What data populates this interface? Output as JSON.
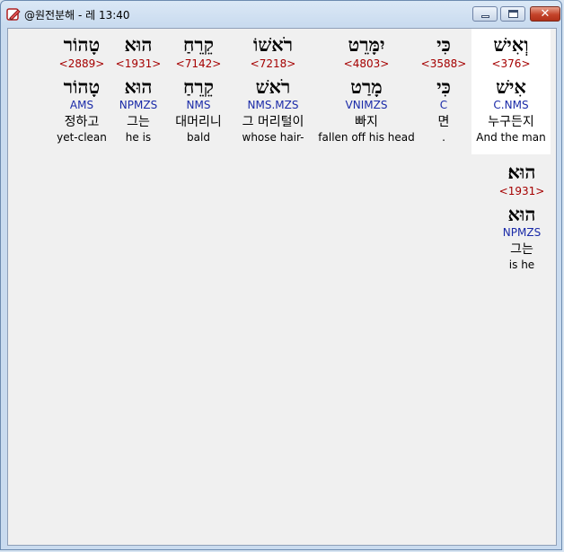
{
  "window": {
    "title": "@원전분해 - 레 13:40",
    "app_icon": "bible-pen-icon",
    "buttons": {
      "minimize": "minimize",
      "maximize": "maximize",
      "close": "✕"
    }
  },
  "words": [
    {
      "hebrew": "וְאִישׁ",
      "strong": "<376>",
      "lemma": "אִישׁ",
      "morph": "C.NMS",
      "korean": "누구든지",
      "english": "And the man",
      "selected": true
    },
    {
      "hebrew": "כִּי",
      "strong": "<3588>",
      "lemma": "כִּי",
      "morph": "C",
      "korean": "면",
      "english": "."
    },
    {
      "hebrew": "יִמָּרֵט",
      "strong": "<4803>",
      "lemma": "מָרַט",
      "morph": "VNIMZS",
      "korean": "빠지",
      "english": "fallen off his head"
    },
    {
      "hebrew": "רֹאשׁוֹ",
      "strong": "<7218>",
      "lemma": "רֹאשׁ",
      "morph": "NMS.MZS",
      "korean": "그 머리털이",
      "english": "whose hair-"
    },
    {
      "hebrew": "קֵרֵחַ",
      "strong": "<7142>",
      "lemma": "קֵרֵחַ",
      "morph": "NMS",
      "korean": "대머리니",
      "english": "bald"
    },
    {
      "hebrew": "הוּא",
      "strong": "<1931>",
      "lemma": "הוּא",
      "morph": "NPMZS",
      "korean": "그는",
      "english": "he is"
    },
    {
      "hebrew": "טָהוֹר",
      "strong": "<2889>",
      "lemma": "טָהוֹר",
      "morph": "AMS",
      "korean": "정하고",
      "english": "yet-clean"
    },
    {
      "hebrew": "הוּא׃",
      "strong": "<1931>",
      "lemma": "הוּא",
      "morph": "NPMZS",
      "korean": "그는",
      "english": "is he"
    }
  ],
  "colors": {
    "strong": "#a50000",
    "morph": "#1a2aa8",
    "selected_bg": "#ffffff",
    "client_bg": "#f0f0f0"
  }
}
